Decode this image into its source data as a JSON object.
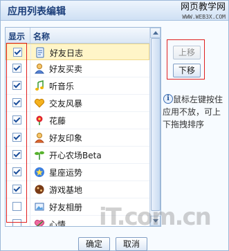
{
  "window": {
    "title": "应用列表编辑",
    "watermark_top": "网页教学网",
    "watermark_top_small": "WWW.WEB3X.COM",
    "watermark_bottom": "iT.com.cn"
  },
  "list": {
    "header_show": "显示",
    "header_name": "名称",
    "items": [
      {
        "label": "好友日志",
        "checked": true,
        "icon": "notebook-icon",
        "selected": true
      },
      {
        "label": "好友买卖",
        "checked": true,
        "icon": "person-icon",
        "selected": false
      },
      {
        "label": "听音乐",
        "checked": true,
        "icon": "music-icon",
        "selected": false
      },
      {
        "label": "交友风暴",
        "checked": true,
        "icon": "heart-icon",
        "selected": false
      },
      {
        "label": "花藤",
        "checked": true,
        "icon": "flower-icon",
        "selected": false
      },
      {
        "label": "好友印象",
        "checked": true,
        "icon": "person-icon",
        "selected": false
      },
      {
        "label": "开心农场Beta",
        "checked": true,
        "icon": "sprout-icon",
        "selected": false
      },
      {
        "label": "星座运势",
        "checked": true,
        "icon": "star-icon",
        "selected": false
      },
      {
        "label": "游戏基地",
        "checked": true,
        "icon": "game-icon",
        "selected": false
      },
      {
        "label": "好友相册",
        "checked": false,
        "icon": "album-icon",
        "selected": false
      },
      {
        "label": "心情",
        "checked": false,
        "icon": "mood-icon",
        "selected": false
      }
    ]
  },
  "buttons": {
    "move_up": "上移",
    "move_down": "下移",
    "ok": "确定",
    "cancel": "取消"
  },
  "help_text": "鼠标左键按住应用不放，可上下拖拽排序",
  "colors": {
    "highlight_border": "#e01d1d",
    "title_text": "#1c3f7a",
    "selected_row": "#fff5c8"
  }
}
